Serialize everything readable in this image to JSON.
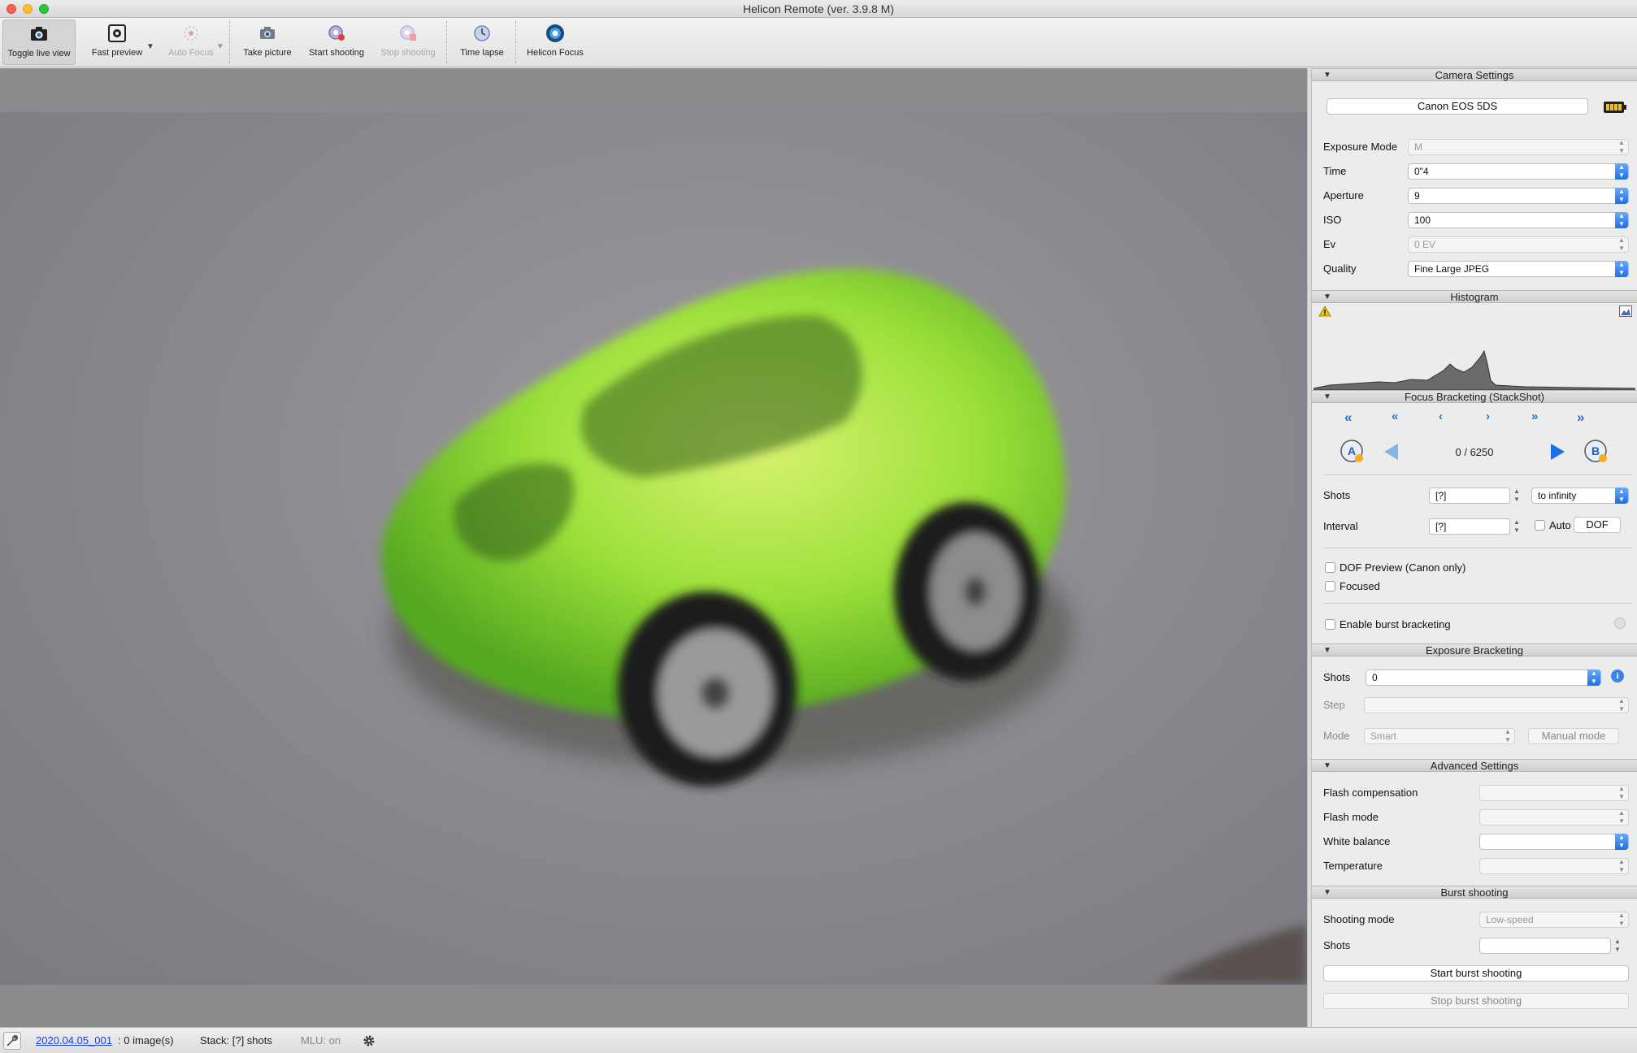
{
  "window": {
    "title": "Helicon Remote (ver. 3.9.8 M)"
  },
  "toolbar": {
    "items": [
      {
        "label": "Toggle live view",
        "icon": "camera-liveview-icon"
      },
      {
        "label": "Fast preview",
        "icon": "fast-preview-icon"
      },
      {
        "label": "Auto Focus",
        "icon": "auto-focus-icon"
      },
      {
        "label": "Take picture",
        "icon": "take-picture-icon"
      },
      {
        "label": "Start shooting",
        "icon": "start-shooting-icon"
      },
      {
        "label": "Stop shooting",
        "icon": "stop-shooting-icon"
      },
      {
        "label": "Time lapse",
        "icon": "time-lapse-icon"
      },
      {
        "label": "Helicon Focus",
        "icon": "helicon-focus-icon"
      }
    ]
  },
  "camera_settings": {
    "header": "Camera Settings",
    "camera_name": "Canon EOS 5DS",
    "rows": [
      {
        "label": "Exposure Mode",
        "value": "M"
      },
      {
        "label": "Time",
        "value": "0\"4"
      },
      {
        "label": "Aperture",
        "value": "9"
      },
      {
        "label": "ISO",
        "value": "100"
      },
      {
        "label": "Ev",
        "value": "0 EV"
      },
      {
        "label": "Quality",
        "value": "Fine Large JPEG"
      }
    ]
  },
  "histogram": {
    "header": "Histogram"
  },
  "focus_bracketing": {
    "header": "Focus Bracketing (StackShot)",
    "counter": "0 / 6250",
    "shots_label": "Shots",
    "shots_value": "[?]",
    "shots_mode": "to infinity",
    "interval_label": "Interval",
    "interval_value": "[?]",
    "auto_label": "Auto",
    "dof_label": "DOF",
    "dof_preview_label": "DOF Preview (Canon only)",
    "focused_label": "Focused",
    "burst_label": "Enable burst bracketing"
  },
  "exposure_bracketing": {
    "header": "Exposure Bracketing",
    "shots_label": "Shots",
    "shots_value": "0",
    "step_label": "Step",
    "mode_label": "Mode",
    "mode_value": "Smart",
    "manual_label": "Manual mode"
  },
  "advanced_settings": {
    "header": "Advanced Settings",
    "rows": [
      {
        "label": "Flash compensation"
      },
      {
        "label": "Flash mode"
      },
      {
        "label": "White balance"
      },
      {
        "label": "Temperature"
      }
    ]
  },
  "burst_shooting": {
    "header": "Burst shooting",
    "mode_label": "Shooting mode",
    "mode_value": "Low-speed",
    "shots_label": "Shots",
    "start_label": "Start burst shooting",
    "stop_label": "Stop burst shooting"
  },
  "status": {
    "session_link": "2020.04.05_001",
    "images": ": 0 image(s)",
    "stack": "Stack: [?] shots",
    "mlu": "MLU: on"
  },
  "colors": {
    "accent": "#1d6fe8",
    "subject_green": "#9be03a",
    "link": "#1a3fd6"
  }
}
